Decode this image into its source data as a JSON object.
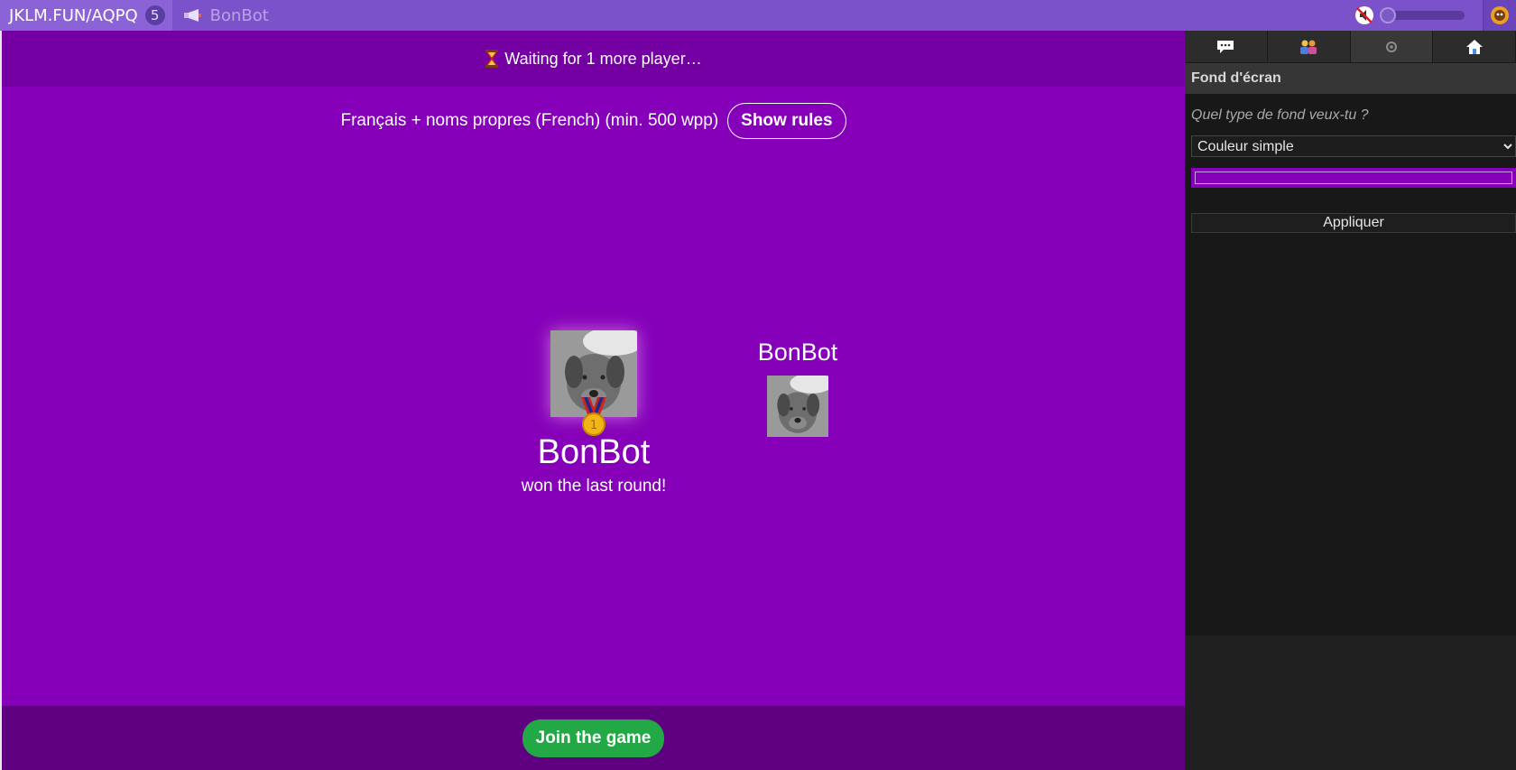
{
  "topbar": {
    "room_code": "JKLM.FUN/AQPQ",
    "player_count": "5",
    "host_name": "BonBot",
    "icons": {
      "host": "megaphone-icon",
      "mute": "mute-icon",
      "profile": "profile-icon"
    }
  },
  "game": {
    "status_text": "Waiting for 1 more player…",
    "rules_text": "Français + noms propres (French) (min. 500 wpp)",
    "show_rules_label": "Show rules",
    "winner_name": "BonBot",
    "winner_subtitle": "won the last round!",
    "player_name": "BonBot",
    "join_label": "Join the game",
    "colors": {
      "background": "#8500b8",
      "join_button": "#22a844"
    }
  },
  "sidebar": {
    "tabs": [
      "chat-icon",
      "players-icon",
      "settings-icon",
      "home-icon"
    ],
    "section_title": "Fond d'écran",
    "question": "Quel type de fond veux-tu ?",
    "select_value": "Couleur simple",
    "apply_label": "Appliquer",
    "selected_color": "#8500b8"
  }
}
